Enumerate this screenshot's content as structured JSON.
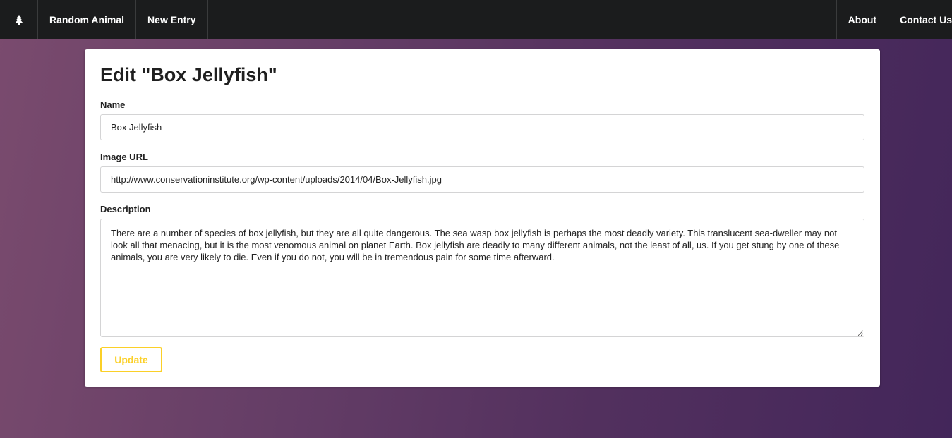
{
  "nav": {
    "logo_icon": "tree-icon",
    "left_items": [
      "Random Animal",
      "New Entry"
    ],
    "right_items": [
      "About",
      "Contact Us"
    ]
  },
  "form": {
    "title": "Edit \"Box Jellyfish\"",
    "name_label": "Name",
    "name_value": "Box Jellyfish",
    "image_label": "Image URL",
    "image_value": "http://www.conservationinstitute.org/wp-content/uploads/2014/04/Box-Jellyfish.jpg",
    "description_label": "Description",
    "description_value": "There are a number of species of box jellyfish, but they are all quite dangerous. The sea wasp box jellyfish is perhaps the most deadly variety. This translucent sea-dweller may not look all that menacing, but it is the most venomous animal on planet Earth. Box jellyfish are deadly to many different animals, not the least of all, us. If you get stung by one of these animals, you are very likely to die. Even if you do not, you will be in tremendous pain for some time afterward.",
    "update_label": "Update"
  },
  "colors": {
    "navbar": "#1b1c1d",
    "accent": "#fbd028",
    "gradient_start": "#7a4b6e",
    "gradient_end": "#43265a"
  }
}
